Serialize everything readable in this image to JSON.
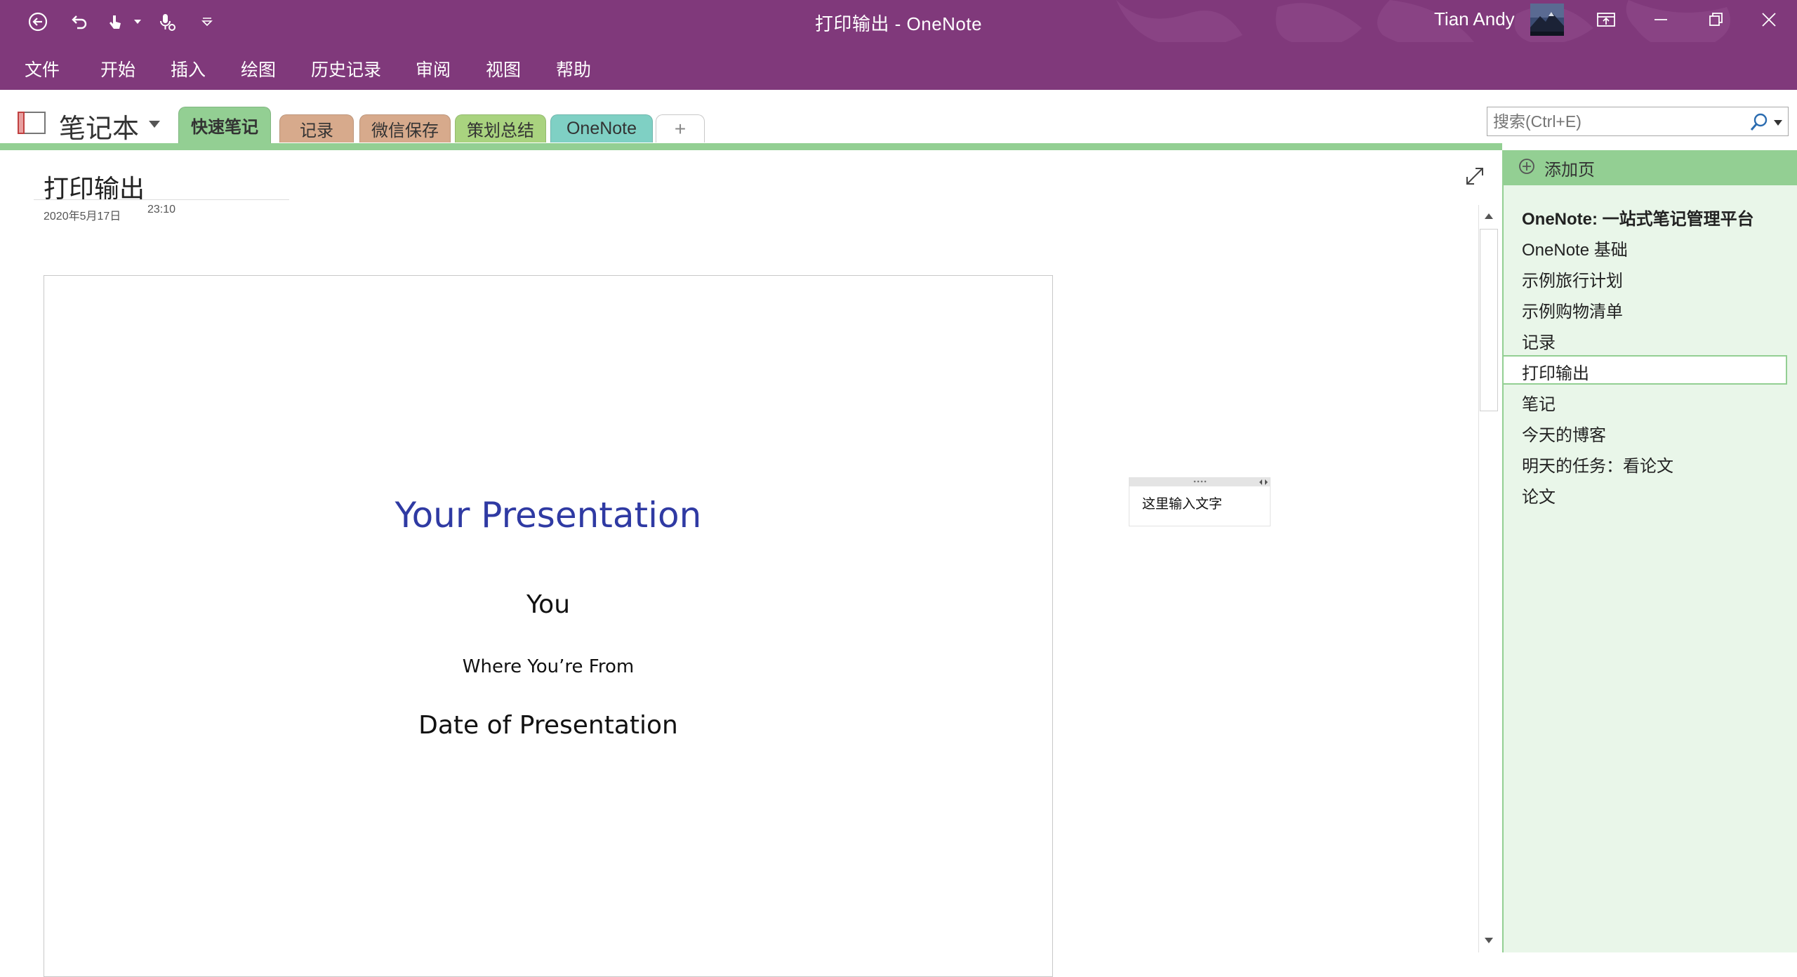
{
  "window": {
    "title": "打印输出  -  OneNote",
    "user_name": "Tian Andy"
  },
  "quick_access": [
    "back-icon",
    "undo-icon",
    "touch-mode-icon",
    "dropdown-icon",
    "dictate-icon",
    "customize-icon"
  ],
  "menu": {
    "items": [
      "文件",
      "开始",
      "插入",
      "绘图",
      "历史记录",
      "审阅",
      "视图",
      "帮助"
    ]
  },
  "notebook": {
    "name": "笔记本",
    "sections": [
      {
        "label": "快速笔记",
        "color": "#93cf93",
        "active": true
      },
      {
        "label": "记录",
        "color": "#d7aa8c"
      },
      {
        "label": "微信保存",
        "color": "#d7aa8c"
      },
      {
        "label": "策划总结",
        "color": "#a9d37f"
      },
      {
        "label": "OneNote",
        "color": "#7fd0c4"
      },
      {
        "label": "+",
        "color": "#ffffff"
      }
    ]
  },
  "search": {
    "placeholder": "搜索(Ctrl+E)"
  },
  "page": {
    "title": "打印输出",
    "date": "2020年5月17日",
    "time": "23:10",
    "slide": {
      "title": "Your Presentation",
      "author": "You",
      "from": "Where You’re From",
      "date": "Date of Presentation"
    },
    "note_text": "这里输入文字"
  },
  "pages_panel": {
    "add_page_label": "添加页",
    "items": [
      "OneNote: 一站式笔记管理平台",
      "OneNote 基础",
      "示例旅行计划",
      "示例购物清单",
      "记录",
      "打印输出",
      "笔记",
      "今天的博客",
      "明天的任务：看论文",
      "论文"
    ],
    "selected": "打印输出"
  },
  "colors": {
    "title_bar": "#80397b",
    "section_green": "#93cf93",
    "page_list_bg": "#e9f6e9",
    "slide_title": "#2f3aa3"
  }
}
